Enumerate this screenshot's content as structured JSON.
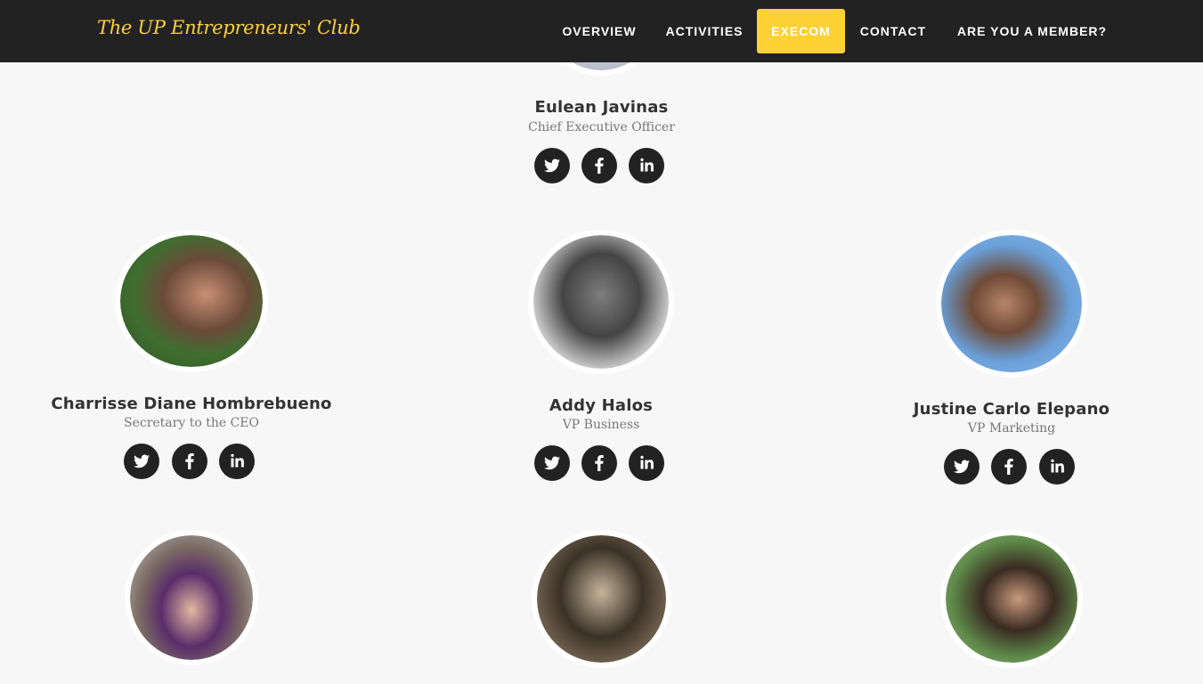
{
  "brand": "The UP Entrepreneurs' Club",
  "nav": [
    {
      "label": "OVERVIEW"
    },
    {
      "label": "ACTIVITIES"
    },
    {
      "label": "EXECOM"
    },
    {
      "label": "CONTACT"
    },
    {
      "label": "ARE YOU A MEMBER?"
    }
  ],
  "colors": {
    "navbar": "#222222",
    "accent": "#fed136",
    "background": "#f7f7f7"
  },
  "members": [
    {
      "name": "Eulean Javinas",
      "role": "Chief Executive Officer"
    },
    {
      "name": "Charrisse Diane Hombrebueno",
      "role": "Secretary to the CEO"
    },
    {
      "name": "Addy Halos",
      "role": "VP Business"
    },
    {
      "name": "Justine Carlo Elepano",
      "role": "VP Marketing"
    }
  ],
  "social_icons": [
    "twitter-icon",
    "facebook-icon",
    "linkedin-icon"
  ]
}
